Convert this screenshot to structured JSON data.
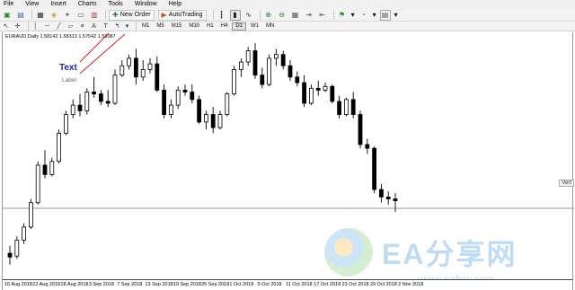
{
  "menu": [
    "File",
    "View",
    "Insert",
    "Charts",
    "Tools",
    "Window",
    "Help"
  ],
  "toolbar": {
    "new_order": "New Order",
    "auto_trading": "AutoTrading"
  },
  "timeframes": [
    {
      "label": "M1",
      "active": false
    },
    {
      "label": "M5",
      "active": false
    },
    {
      "label": "M15",
      "active": false
    },
    {
      "label": "M30",
      "active": false
    },
    {
      "label": "H1",
      "active": false
    },
    {
      "label": "H4",
      "active": false
    },
    {
      "label": "D1",
      "active": true
    },
    {
      "label": "W1",
      "active": false
    },
    {
      "label": "MN",
      "active": false
    }
  ],
  "chart": {
    "symbol_info": "EURAUD,Daily  1.58142 1.58313 1.57542 1.58087",
    "text_object": "Text",
    "label_object": "Label",
    "vertical_line_tab": "Vert"
  },
  "watermark": {
    "big": "EA分享网",
    "url": "www.eafxw.com"
  },
  "date_axis": [
    "16 Aug 2018",
    "22 Aug 2018",
    "28 Aug 2018",
    "3 Sep 2018",
    "7 Sep 2018",
    "13 Sep 2018",
    "19 Sep 2018",
    "25 Sep 2018",
    "1 Oct 2018",
    "5 Oct 2018",
    "11 Oct 2018",
    "17 Oct 2018",
    "23 Oct 2018",
    "29 Oct 2018",
    "2 Nov 2018"
  ],
  "chart_data": {
    "type": "candlestick",
    "symbol": "EURAUD",
    "timeframe": "Daily",
    "candles": [
      {
        "o": 1.566,
        "h": 1.57,
        "l": 1.56,
        "c": 1.564
      },
      {
        "o": 1.5645,
        "h": 1.575,
        "l": 1.563,
        "c": 1.573
      },
      {
        "o": 1.573,
        "h": 1.582,
        "l": 1.571,
        "c": 1.58
      },
      {
        "o": 1.58,
        "h": 1.595,
        "l": 1.579,
        "c": 1.593
      },
      {
        "o": 1.593,
        "h": 1.615,
        "l": 1.592,
        "c": 1.613
      },
      {
        "o": 1.613,
        "h": 1.621,
        "l": 1.606,
        "c": 1.608
      },
      {
        "o": 1.608,
        "h": 1.617,
        "l": 1.607,
        "c": 1.615
      },
      {
        "o": 1.615,
        "h": 1.632,
        "l": 1.614,
        "c": 1.63
      },
      {
        "o": 1.63,
        "h": 1.642,
        "l": 1.629,
        "c": 1.64
      },
      {
        "o": 1.64,
        "h": 1.648,
        "l": 1.638,
        "c": 1.645
      },
      {
        "o": 1.645,
        "h": 1.651,
        "l": 1.639,
        "c": 1.642
      },
      {
        "o": 1.642,
        "h": 1.654,
        "l": 1.64,
        "c": 1.652
      },
      {
        "o": 1.652,
        "h": 1.66,
        "l": 1.649,
        "c": 1.651
      },
      {
        "o": 1.651,
        "h": 1.653,
        "l": 1.645,
        "c": 1.647
      },
      {
        "o": 1.647,
        "h": 1.653,
        "l": 1.644,
        "c": 1.646
      },
      {
        "o": 1.646,
        "h": 1.664,
        "l": 1.645,
        "c": 1.661
      },
      {
        "o": 1.661,
        "h": 1.669,
        "l": 1.66,
        "c": 1.666
      },
      {
        "o": 1.666,
        "h": 1.672,
        "l": 1.664,
        "c": 1.67
      },
      {
        "o": 1.67,
        "h": 1.675,
        "l": 1.656,
        "c": 1.66
      },
      {
        "o": 1.66,
        "h": 1.669,
        "l": 1.658,
        "c": 1.664
      },
      {
        "o": 1.664,
        "h": 1.67,
        "l": 1.662,
        "c": 1.667
      },
      {
        "o": 1.667,
        "h": 1.671,
        "l": 1.652,
        "c": 1.653
      },
      {
        "o": 1.653,
        "h": 1.656,
        "l": 1.638,
        "c": 1.64
      },
      {
        "o": 1.64,
        "h": 1.648,
        "l": 1.638,
        "c": 1.645
      },
      {
        "o": 1.645,
        "h": 1.655,
        "l": 1.643,
        "c": 1.653
      },
      {
        "o": 1.653,
        "h": 1.656,
        "l": 1.65,
        "c": 1.652
      },
      {
        "o": 1.652,
        "h": 1.656,
        "l": 1.646,
        "c": 1.648
      },
      {
        "o": 1.648,
        "h": 1.65,
        "l": 1.635,
        "c": 1.636
      },
      {
        "o": 1.636,
        "h": 1.642,
        "l": 1.632,
        "c": 1.64
      },
      {
        "o": 1.64,
        "h": 1.644,
        "l": 1.63,
        "c": 1.633
      },
      {
        "o": 1.633,
        "h": 1.642,
        "l": 1.632,
        "c": 1.64
      },
      {
        "o": 1.64,
        "h": 1.652,
        "l": 1.639,
        "c": 1.651
      },
      {
        "o": 1.651,
        "h": 1.666,
        "l": 1.65,
        "c": 1.664
      },
      {
        "o": 1.664,
        "h": 1.67,
        "l": 1.66,
        "c": 1.668
      },
      {
        "o": 1.668,
        "h": 1.676,
        "l": 1.666,
        "c": 1.674
      },
      {
        "o": 1.674,
        "h": 1.678,
        "l": 1.659,
        "c": 1.661
      },
      {
        "o": 1.661,
        "h": 1.665,
        "l": 1.654,
        "c": 1.656
      },
      {
        "o": 1.656,
        "h": 1.672,
        "l": 1.655,
        "c": 1.67
      },
      {
        "o": 1.67,
        "h": 1.675,
        "l": 1.666,
        "c": 1.672
      },
      {
        "o": 1.672,
        "h": 1.674,
        "l": 1.664,
        "c": 1.666
      },
      {
        "o": 1.666,
        "h": 1.669,
        "l": 1.658,
        "c": 1.66
      },
      {
        "o": 1.66,
        "h": 1.663,
        "l": 1.655,
        "c": 1.657
      },
      {
        "o": 1.657,
        "h": 1.661,
        "l": 1.644,
        "c": 1.646
      },
      {
        "o": 1.646,
        "h": 1.656,
        "l": 1.645,
        "c": 1.654
      },
      {
        "o": 1.654,
        "h": 1.658,
        "l": 1.65,
        "c": 1.653
      },
      {
        "o": 1.653,
        "h": 1.657,
        "l": 1.652,
        "c": 1.655
      },
      {
        "o": 1.655,
        "h": 1.656,
        "l": 1.646,
        "c": 1.647
      },
      {
        "o": 1.647,
        "h": 1.65,
        "l": 1.638,
        "c": 1.64
      },
      {
        "o": 1.64,
        "h": 1.649,
        "l": 1.639,
        "c": 1.648
      },
      {
        "o": 1.648,
        "h": 1.652,
        "l": 1.638,
        "c": 1.64
      },
      {
        "o": 1.64,
        "h": 1.642,
        "l": 1.622,
        "c": 1.624
      },
      {
        "o": 1.624,
        "h": 1.627,
        "l": 1.619,
        "c": 1.622
      },
      {
        "o": 1.622,
        "h": 1.623,
        "l": 1.598,
        "c": 1.6
      },
      {
        "o": 1.6,
        "h": 1.603,
        "l": 1.593,
        "c": 1.596
      },
      {
        "o": 1.596,
        "h": 1.599,
        "l": 1.592,
        "c": 1.595
      },
      {
        "o": 1.595,
        "h": 1.598,
        "l": 1.588,
        "c": 1.594
      }
    ],
    "price_range": [
      1.556,
      1.68
    ],
    "crosshair_price": 1.59,
    "grid": false
  }
}
